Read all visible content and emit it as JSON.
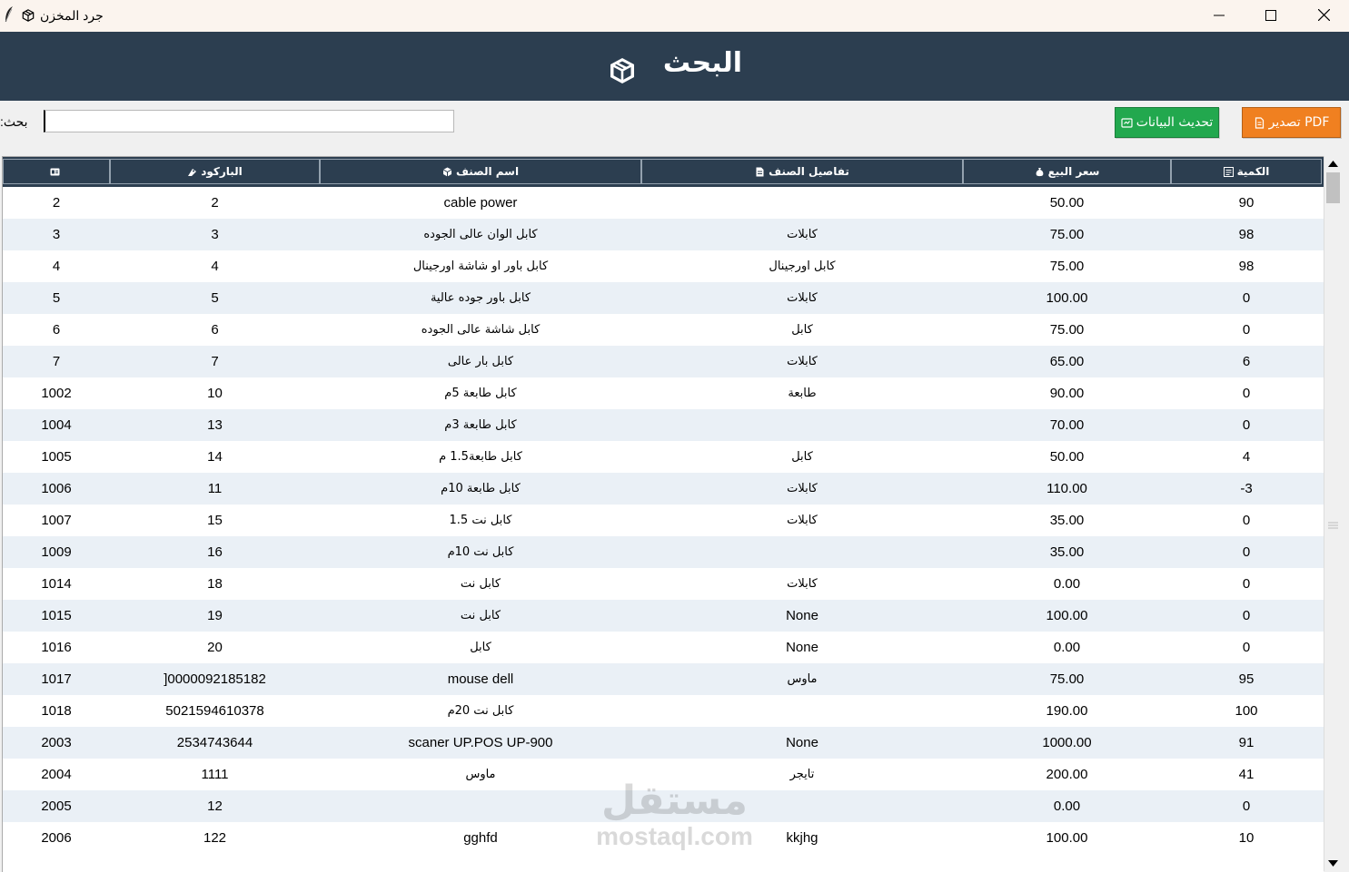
{
  "window": {
    "title": "جرد المخزن",
    "controls": [
      "minimize-icon",
      "maximize-icon",
      "close-icon"
    ]
  },
  "header": {
    "title": "البحث",
    "icon": "package-box-icon"
  },
  "toolbar": {
    "search_label": ":بحث",
    "search_value": "",
    "refresh_label": "تحديث البيانات",
    "pdf_label": "PDF تصدير",
    "refresh_color": "#22a84e",
    "pdf_color": "#f08020"
  },
  "colors": {
    "header_bg": "#2c3e50",
    "row_alt": "#eaf0f6"
  },
  "table": {
    "columns": [
      {
        "key": "qty",
        "label": "الكمية",
        "icon": "inventory-icon"
      },
      {
        "key": "price",
        "label": "سعر البيع",
        "icon": "money-bag-icon"
      },
      {
        "key": "details",
        "label": "تفاصيل الصنف",
        "icon": "document-icon"
      },
      {
        "key": "name",
        "label": "اسم الصنف",
        "icon": "package-icon"
      },
      {
        "key": "barcode",
        "label": "الباركود",
        "icon": "barcode-icon"
      },
      {
        "key": "id",
        "label": "",
        "icon": "id-icon"
      }
    ],
    "rows": [
      {
        "id": "2",
        "barcode": "2",
        "name": "cable power",
        "details": "",
        "price": "50.00",
        "qty": "90"
      },
      {
        "id": "3",
        "barcode": "3",
        "name": "كابل الوان عالى الجوده",
        "details": "كابلات",
        "price": "75.00",
        "qty": "98"
      },
      {
        "id": "4",
        "barcode": "4",
        "name": "كابل باور او شاشة اورجينال",
        "details": "كابل اورجينال",
        "price": "75.00",
        "qty": "98"
      },
      {
        "id": "5",
        "barcode": "5",
        "name": "كابل باور جوده عالية",
        "details": "كابلات",
        "price": "100.00",
        "qty": "0"
      },
      {
        "id": "6",
        "barcode": "6",
        "name": "كابل شاشة عالى الجوده",
        "details": "كابل",
        "price": "75.00",
        "qty": "0"
      },
      {
        "id": "7",
        "barcode": "7",
        "name": "كابل بار عالى",
        "details": "كابلات",
        "price": "65.00",
        "qty": "6"
      },
      {
        "id": "1002",
        "barcode": "10",
        "name": "كابل طابعة  5م",
        "details": "طابعة",
        "price": "90.00",
        "qty": "0"
      },
      {
        "id": "1004",
        "barcode": "13",
        "name": "كابل طابعة 3م",
        "details": "",
        "price": "70.00",
        "qty": "0"
      },
      {
        "id": "1005",
        "barcode": "14",
        "name": "كابل طابعة1.5 م",
        "details": "كابل",
        "price": "50.00",
        "qty": "4"
      },
      {
        "id": "1006",
        "barcode": "11",
        "name": "كابل طابعة 10م",
        "details": "كابلات",
        "price": "110.00",
        "qty": "-3"
      },
      {
        "id": "1007",
        "barcode": "15",
        "name": "كابل نت 1.5",
        "details": "كابلات",
        "price": "35.00",
        "qty": "0"
      },
      {
        "id": "1009",
        "barcode": "16",
        "name": "كابل نت 10م",
        "details": "",
        "price": "35.00",
        "qty": "0"
      },
      {
        "id": "1014",
        "barcode": "18",
        "name": "كابل نت",
        "details": "كابلات",
        "price": "0.00",
        "qty": "0"
      },
      {
        "id": "1015",
        "barcode": "19",
        "name": "كابل نت",
        "details": "None",
        "price": "100.00",
        "qty": "0"
      },
      {
        "id": "1016",
        "barcode": "20",
        "name": "كابل",
        "details": "None",
        "price": "0.00",
        "qty": "0"
      },
      {
        "id": "1017",
        "barcode": "]0000092185182",
        "name": "mouse dell",
        "details": "ماوس",
        "price": "75.00",
        "qty": "95"
      },
      {
        "id": "1018",
        "barcode": "5021594610378",
        "name": "كابل نت 20م",
        "details": "",
        "price": "190.00",
        "qty": "100"
      },
      {
        "id": "2003",
        "barcode": "2534743644",
        "name": "scaner UP.POS UP-900",
        "details": "None",
        "price": "1000.00",
        "qty": "91"
      },
      {
        "id": "2004",
        "barcode": "1111",
        "name": "ماوس",
        "details": "تايجر",
        "price": "200.00",
        "qty": "41"
      },
      {
        "id": "2005",
        "barcode": "12",
        "name": "",
        "details": "",
        "price": "0.00",
        "qty": "0"
      },
      {
        "id": "2006",
        "barcode": "122",
        "name": "gghfd",
        "details": "kkjhg",
        "price": "100.00",
        "qty": "10"
      }
    ]
  },
  "watermark": {
    "arabic": "مستقل",
    "latin": "mostaql.com"
  }
}
